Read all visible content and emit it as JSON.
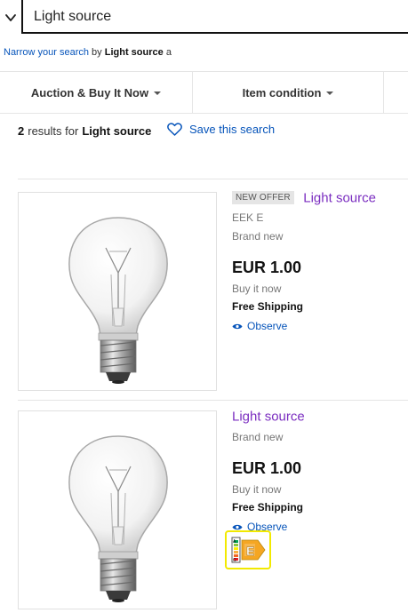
{
  "search": {
    "value": "Light source"
  },
  "narrow": {
    "link": "Narrow your search",
    "by": "by",
    "term": "Light source",
    "suffix": "a"
  },
  "filters": {
    "auction_buy": "Auction & Buy It Now",
    "item_condition": "Item condition"
  },
  "results": {
    "count": "2",
    "text": "results for",
    "term": "Light source"
  },
  "save_search": "Save this search",
  "listings": [
    {
      "badge": "NEW OFFER",
      "title": "Light source",
      "subtitle": "EEK E",
      "condition": "Brand new",
      "price": "EUR 1.00",
      "buy_format": "Buy it now",
      "shipping": "Free Shipping",
      "observe": "Observe",
      "image": "light-bulb"
    },
    {
      "title": "Light source",
      "condition": "Brand new",
      "price": "EUR 1.00",
      "buy_format": "Buy it now",
      "shipping": "Free Shipping",
      "observe": "Observe",
      "image": "light-bulb",
      "energy_label": {
        "scale_top": "A",
        "scale_bottom": "G",
        "class": "E"
      }
    }
  ],
  "colors": {
    "link_blue": "#0654ba",
    "title_purple": "#7b2ec0",
    "energy_label_border": "#f2e900",
    "energy_class_fill": "#f5a623"
  },
  "icons": {
    "back": "chevron-down-icon",
    "save": "heart-icon",
    "observe": "eye-icon",
    "filter_caret": "caret-down-icon"
  }
}
